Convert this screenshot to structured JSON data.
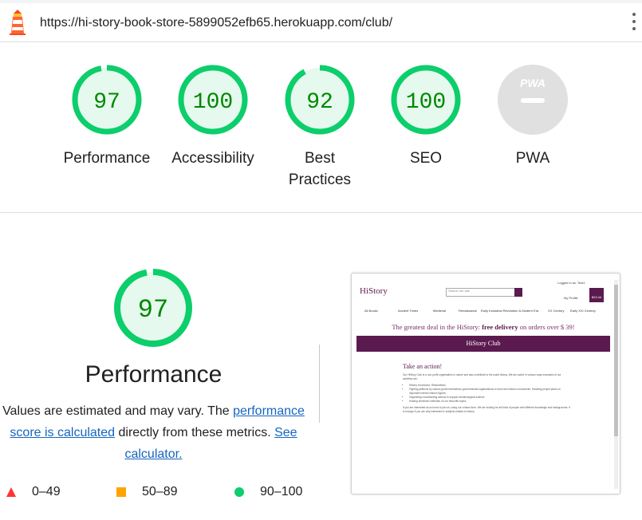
{
  "browser": {
    "url": "https://hi-story-book-store-5899052efb65.herokuapp.com/club/"
  },
  "colors": {
    "pass": "#0cce6b",
    "pass_fill": "#e6f9ee",
    "pass_text": "#008800",
    "average": "#ffa400",
    "fail": "#ff3333",
    "na": "#e0e0e0"
  },
  "gauges": [
    {
      "score": "97",
      "label": "Performance",
      "fraction": 0.97
    },
    {
      "score": "100",
      "label": "Accessibility",
      "fraction": 1.0
    },
    {
      "score": "92",
      "label": "Best Practices",
      "fraction": 0.92
    },
    {
      "score": "100",
      "label": "SEO",
      "fraction": 1.0
    },
    {
      "score": "",
      "label": "PWA",
      "badge": "PWA"
    }
  ],
  "performance": {
    "score": "97",
    "fraction": 0.97,
    "title": "Performance",
    "desc_part1": "Values are estimated and may vary. The ",
    "desc_link1": "performance score is calculated",
    "desc_part2": " directly from these metrics. ",
    "desc_link2": "See calculator."
  },
  "legend": [
    {
      "range": "0–49",
      "shape": "triangle",
      "color": "#ff3333"
    },
    {
      "range": "50–89",
      "shape": "square",
      "color": "#ffa400"
    },
    {
      "range": "90–100",
      "shape": "circle",
      "color": "#0cce6b"
    }
  ],
  "screenshot": {
    "logo": "HiStory",
    "search_placeholder": "Search our site",
    "login_text": "Logged in as: Test1",
    "profile_text": "My Profile",
    "cart_text": "$43.44",
    "nav": [
      "All Books",
      "Ancient Times",
      "Medieval",
      "Renaissance",
      "Early Industrial Revolution & Modern Era",
      "XX Century",
      "Early XXI Century"
    ],
    "banner_prefix": "The greatest deal in the HiStory: ",
    "banner_bold": "free delivery",
    "banner_suffix": " on orders over $ 39!",
    "bar_title": "HiStory Club",
    "heading": "Take an action!",
    "intro": "Our HiStory Club is a non-profit organisation in nature and also contribute to the world history. We are active in various ways examples of our activities are:",
    "bullets": [
      "History excursions. Restorations.",
      "Fighting petitions by various governmental/non-governmental organizations to fund new historic monuments. Handling project plans on important events/ historic figures.",
      "Organising crowdfunding actions to support archaeological science.",
      "Hosting seminars/ webinars on our favourite topics."
    ],
    "outro": "If you are interested as us know to join us, using our contact form. We are looking for all kinds of people with different knowledge and backgrounds. It is enough if you are only interested in subjects related to history."
  }
}
